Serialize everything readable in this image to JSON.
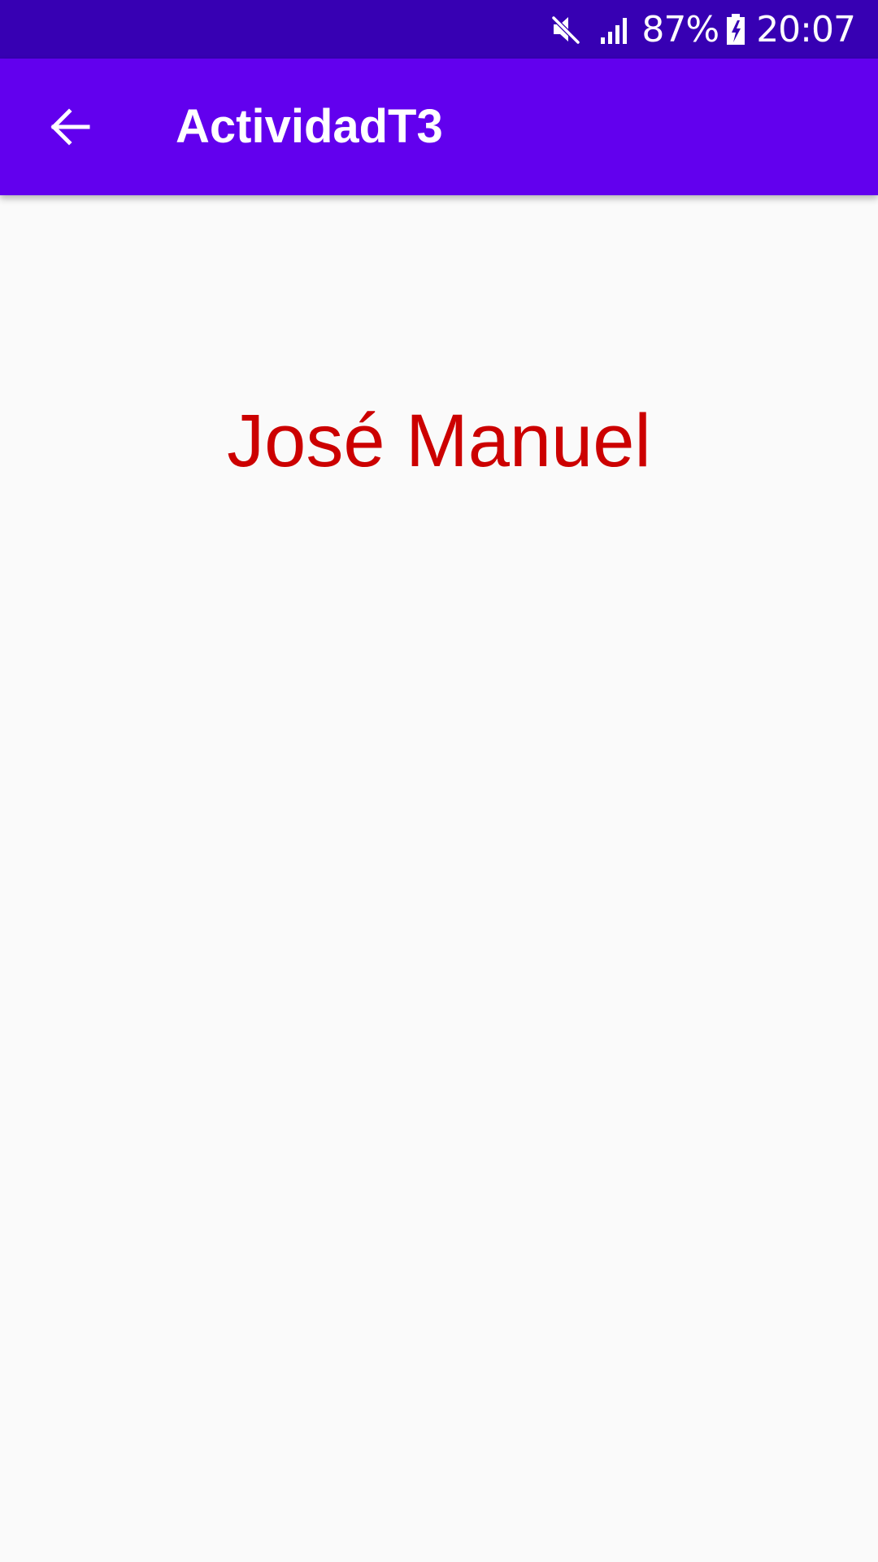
{
  "status_bar": {
    "battery_percent": "87%",
    "time": "20:07",
    "icons": [
      "mute-icon",
      "signal-icon",
      "battery-charging-icon"
    ],
    "background_color": "#3700b3"
  },
  "app_bar": {
    "title": "ActividadT3",
    "back_icon": "arrow-back-icon",
    "background_color": "#6200ee"
  },
  "content": {
    "name_text": "José Manuel",
    "name_color": "#cc0000",
    "background_color": "#fafafa"
  }
}
